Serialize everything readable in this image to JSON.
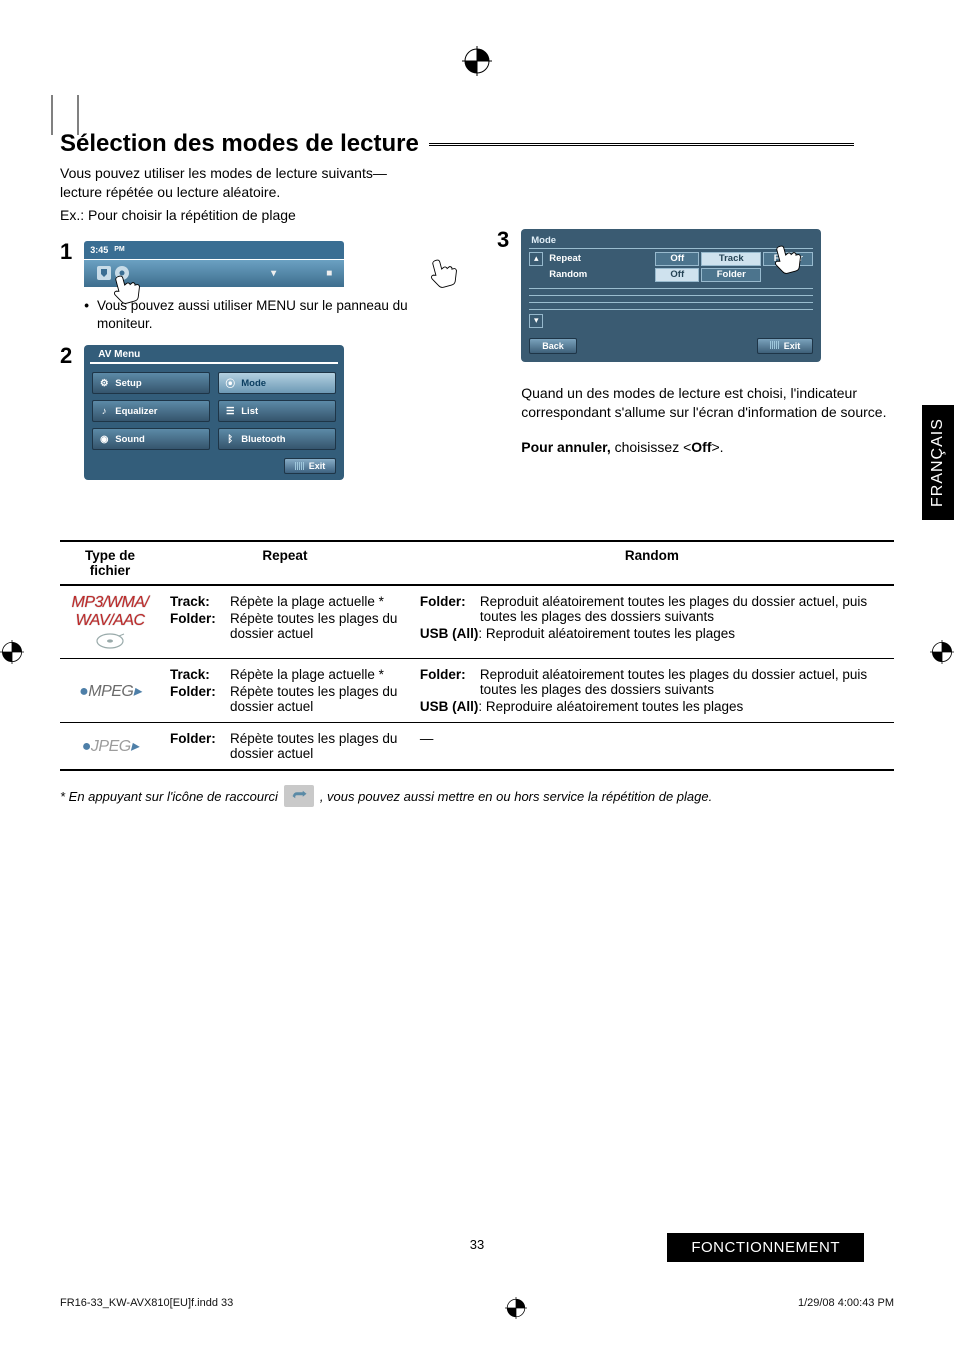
{
  "page": {
    "section_title": "Sélection des modes de lecture",
    "intro_line1": "Vous pouvez utiliser les modes de lecture suivants—lecture répétée ou lecture aléatoire.",
    "intro_line2": "Ex.: Pour choisir la répétition de plage",
    "bullet_monitor": "Vous pouvez aussi utiliser MENU sur le panneau du moniteur.",
    "mode_chosen_text": "Quand un des modes de lecture est choisi, l'indicateur correspondant s'allume sur l'écran d'information de source.",
    "cancel_label": "Pour annuler,",
    "cancel_rest": " choisissez <",
    "cancel_off": "Off",
    "cancel_end": ">.",
    "lang_tab": "FRANÇAIS",
    "page_number": "33",
    "chip": "FONCTIONNEMENT",
    "indd": "FR16-33_KW-AVX810[EU]f.indd   33",
    "timestamp": "1/29/08   4:00:43 PM",
    "footnote_pre": "*   En appuyant sur l'icône de raccourci ",
    "footnote_post": " , vous pouvez aussi mettre en ou hors service la répétition de plage."
  },
  "steps": {
    "s1": "1",
    "s2": "2",
    "s3": "3"
  },
  "screen1": {
    "time": "3:45",
    "pm": "PM"
  },
  "avmenu": {
    "title": "AV Menu",
    "setup": "Setup",
    "mode": "Mode",
    "equalizer": "Equalizer",
    "list": "List",
    "sound": "Sound",
    "bluetooth": "Bluetooth",
    "exit": "Exit"
  },
  "modepanel": {
    "title": "Mode",
    "repeat": "Repeat",
    "random": "Random",
    "off": "Off",
    "track": "Track",
    "folder": "Folder",
    "back": "Back",
    "exit": "Exit"
  },
  "table": {
    "head_type": "Type de fichier",
    "head_repeat": "Repeat",
    "head_random": "Random",
    "r1_type_a": "MP3/WMA/",
    "r1_type_b": "WAV/AAC",
    "k_track": "Track",
    "k_folder": "Folder",
    "k_usb": "USB (All)",
    "r_desc_track": "Répète la plage actuelle *",
    "r_desc_folder": "Répète toutes les plages du dossier actuel",
    "rand_desc_folder": "Reproduit aléatoirement toutes les plages du dossier actuel, puis toutes les plages des dossiers suivants",
    "rand_desc_usb1": ": Reproduit aléatoirement toutes les plages",
    "rand_desc_usb2": ": Reproduire aléatoirement toutes les plages",
    "r3_type": "JPEG",
    "r2_type": "MPEG"
  }
}
